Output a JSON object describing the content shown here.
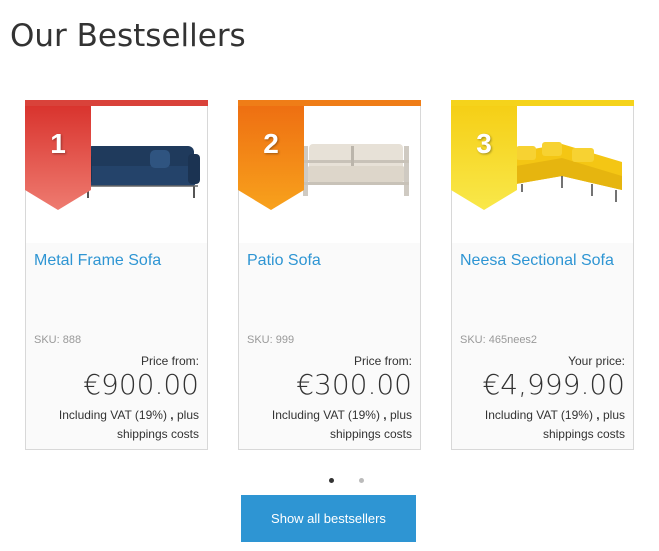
{
  "page_title": "Our Bestsellers",
  "colors": {
    "accent": "#2e95d3",
    "rank1": "#d9423a",
    "rank2": "#ef7d17",
    "rank3": "#f5d31b"
  },
  "products": [
    {
      "rank": "1",
      "name": "Metal Frame Sofa",
      "sku": "SKU: 888",
      "price_label": "Price from:",
      "price": "€900.00",
      "vat_text": "Including VAT (19%)",
      "vat_sep": ",",
      "shipping_text": "plus shippings costs",
      "image": "navy-sofa-image"
    },
    {
      "rank": "2",
      "name": "Patio Sofa",
      "sku": "SKU: 999",
      "price_label": "Price from:",
      "price": "€300.00",
      "vat_text": "Including VAT (19%)",
      "vat_sep": ",",
      "shipping_text": "plus shippings costs",
      "image": "beige-patio-sofa-image"
    },
    {
      "rank": "3",
      "name": "Neesa Sectional Sofa",
      "sku": "SKU: 465nees2",
      "price_label": "Your price:",
      "price": "€4,999.00",
      "vat_text": "Including VAT (19%)",
      "vat_sep": ",",
      "shipping_text": "plus shippings costs",
      "image": "yellow-sectional-sofa-image"
    }
  ],
  "carousel": {
    "page_count": 2,
    "active_page": 1
  },
  "show_all_label": "Show all bestsellers"
}
